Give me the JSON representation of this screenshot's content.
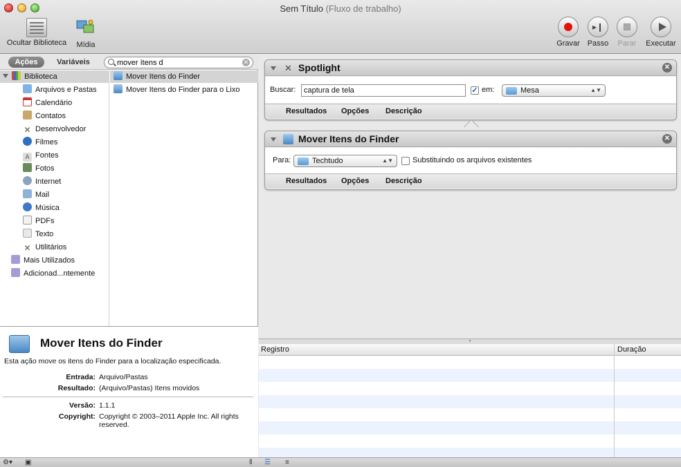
{
  "window": {
    "title": "Sem Título",
    "subtitle": "(Fluxo de trabalho)"
  },
  "toolbar": {
    "hide_library": "Ocultar Biblioteca",
    "media": "Mídia",
    "record": "Gravar",
    "step": "Passo",
    "stop": "Parar",
    "run": "Executar"
  },
  "library": {
    "tab_actions": "Ações",
    "tab_variables": "Variáveis",
    "search_value": "mover ítens d",
    "root": "Biblioteca",
    "items": [
      {
        "label": "Arquivos e Pastas",
        "icon": "finder-icon"
      },
      {
        "label": "Calendário",
        "icon": "calendar-icon"
      },
      {
        "label": "Contatos",
        "icon": "contacts-icon"
      },
      {
        "label": "Desenvolvedor",
        "icon": "developer-icon"
      },
      {
        "label": "Filmes",
        "icon": "movie-icon"
      },
      {
        "label": "Fontes",
        "icon": "font-icon"
      },
      {
        "label": "Fotos",
        "icon": "photo-icon"
      },
      {
        "label": "Internet",
        "icon": "internet-icon"
      },
      {
        "label": "Mail",
        "icon": "mail-icon"
      },
      {
        "label": "Música",
        "icon": "music-icon"
      },
      {
        "label": "PDFs",
        "icon": "pdf-icon"
      },
      {
        "label": "Texto",
        "icon": "text-icon"
      },
      {
        "label": "Utilitários",
        "icon": "utilities-icon"
      }
    ],
    "groups": [
      "Mais Utilizados",
      "Adicionad...ntemente"
    ],
    "actions": [
      "Mover Itens do Finder",
      "Mover Itens do Finder para o Lixo"
    ]
  },
  "info": {
    "title": "Mover Itens do Finder",
    "description": "Esta ação move os itens do Finder para a localização especificada.",
    "input_label": "Entrada:",
    "input_value": "Arquivo/Pastas",
    "result_label": "Resultado:",
    "result_value": "(Arquivo/Pastas) Itens movidos",
    "version_label": "Versão:",
    "version_value": "1.1.1",
    "copyright_label": "Copyright:",
    "copyright_value": "Copyright © 2003–2011 Apple Inc.  All rights reserved."
  },
  "workflow": {
    "spotlight": {
      "title": "Spotlight",
      "search_label": "Buscar:",
      "search_value": "captura de tela",
      "in_label": "em:",
      "in_checked": true,
      "location": "Mesa",
      "tabs": [
        "Resultados",
        "Opções",
        "Descrição"
      ]
    },
    "move": {
      "title": "Mover Itens do Finder",
      "to_label": "Para:",
      "destination": "Techtudo",
      "replace_label": "Substituindo os arquivos existentes",
      "replace_checked": false,
      "tabs": [
        "Resultados",
        "Opções",
        "Descrição"
      ]
    }
  },
  "log": {
    "col_registro": "Registro",
    "col_duracao": "Duração"
  }
}
